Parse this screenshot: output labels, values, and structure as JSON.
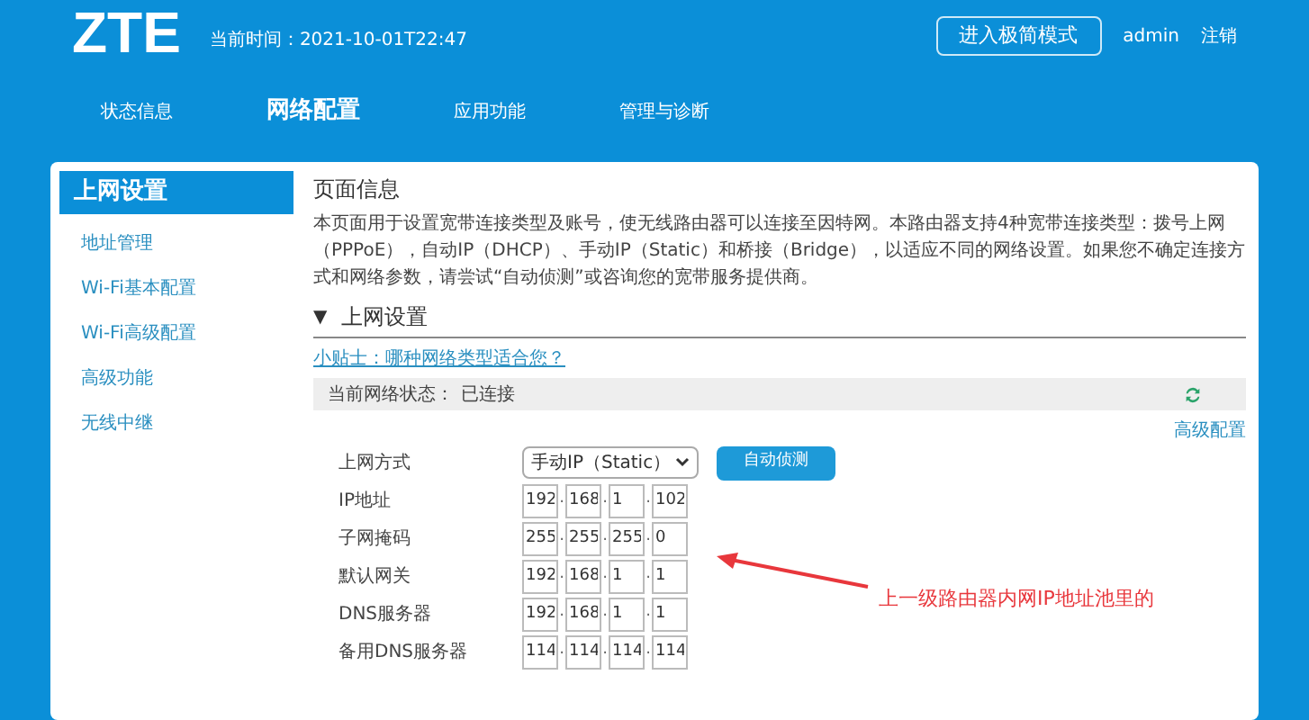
{
  "header": {
    "logo": "ZTE",
    "time": "当前时间：2021-10-01T22:47",
    "mode_button": "进入极简模式",
    "user": "admin",
    "logout": "注销"
  },
  "nav": [
    {
      "label": "状态信息",
      "selected": false
    },
    {
      "label": "网络配置",
      "selected": true
    },
    {
      "label": "应用功能",
      "selected": false
    },
    {
      "label": "管理与诊断",
      "selected": false
    }
  ],
  "sidebar": [
    {
      "label": "上网设置",
      "selected": true
    },
    {
      "label": "地址管理",
      "selected": false
    },
    {
      "label": "Wi-Fi基本配置",
      "selected": false
    },
    {
      "label": "Wi-Fi高级配置",
      "selected": false
    },
    {
      "label": "高级功能",
      "selected": false
    },
    {
      "label": "无线中继",
      "selected": false
    }
  ],
  "page_info": {
    "title": "页面信息",
    "description": "本页面用于设置宽带连接类型及账号，使无线路由器可以连接至因特网。本路由器支持4种宽带连接类型：拨号上网（PPPoE），自动IP（DHCP）、手动IP（Static）和桥接（Bridge），以适应不同的网络设置。如果您不确定连接方式和网络参数，请尝试“自动侦测”或咨询您的宽带服务提供商。"
  },
  "section": {
    "toggle": "▼",
    "title": "上网设置",
    "expanded": true,
    "tip": "小贴士：哪种网络类型适合您？",
    "status_label": "当前网络状态：",
    "status": "已连接",
    "advanced_link": "高级配置",
    "separator": ".",
    "rows": [
      {
        "kind": "select",
        "label": "上网方式",
        "value": "手动IP（Static）",
        "button": "自动侦测"
      },
      {
        "kind": "ip",
        "label": "IP地址",
        "octets": [
          "192",
          "168",
          "1",
          "102"
        ]
      },
      {
        "kind": "ip",
        "label": "子网掩码",
        "octets": [
          "255",
          "255",
          "255",
          "0"
        ]
      },
      {
        "kind": "ip",
        "label": "默认网关",
        "octets": [
          "192",
          "168",
          "1",
          "1"
        ]
      },
      {
        "kind": "ip",
        "label": "DNS服务器",
        "octets": [
          "192",
          "168",
          "1",
          "1"
        ]
      },
      {
        "kind": "ip",
        "label": "备用DNS服务器",
        "octets": [
          "114",
          "114",
          "114",
          "114"
        ]
      }
    ]
  },
  "annotation": {
    "text": "上一级路由器内网IP地址池里的"
  }
}
